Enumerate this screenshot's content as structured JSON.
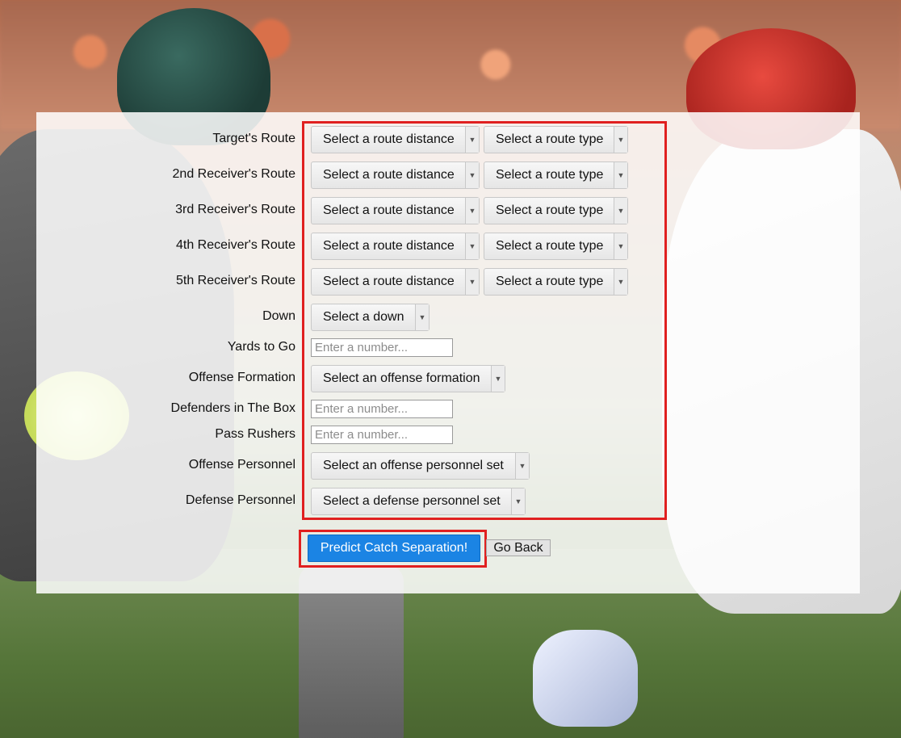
{
  "form": {
    "rows": [
      {
        "label": "Target's Route",
        "distance": "Select a route distance",
        "type": "Select a route type"
      },
      {
        "label": "2nd Receiver's Route",
        "distance": "Select a route distance",
        "type": "Select a route type"
      },
      {
        "label": "3rd Receiver's Route",
        "distance": "Select a route distance",
        "type": "Select a route type"
      },
      {
        "label": "4th Receiver's Route",
        "distance": "Select a route distance",
        "type": "Select a route type"
      },
      {
        "label": "5th Receiver's Route",
        "distance": "Select a route distance",
        "type": "Select a route type"
      }
    ],
    "down": {
      "label": "Down",
      "value": "Select a down"
    },
    "yards_to_go": {
      "label": "Yards to Go",
      "placeholder": "Enter a number..."
    },
    "offense_formation": {
      "label": "Offense Formation",
      "value": "Select an offense formation"
    },
    "defenders_in_box": {
      "label": "Defenders in The Box",
      "placeholder": "Enter a number..."
    },
    "pass_rushers": {
      "label": "Pass Rushers",
      "placeholder": "Enter a number..."
    },
    "offense_personnel": {
      "label": "Offense Personnel",
      "value": "Select an offense personnel set"
    },
    "defense_personnel": {
      "label": "Defense Personnel",
      "value": "Select a defense personnel set"
    }
  },
  "buttons": {
    "predict": "Predict Catch Separation!",
    "back": "Go Back"
  },
  "colors": {
    "accent": "#1b84e4",
    "highlight": "#e02020"
  }
}
